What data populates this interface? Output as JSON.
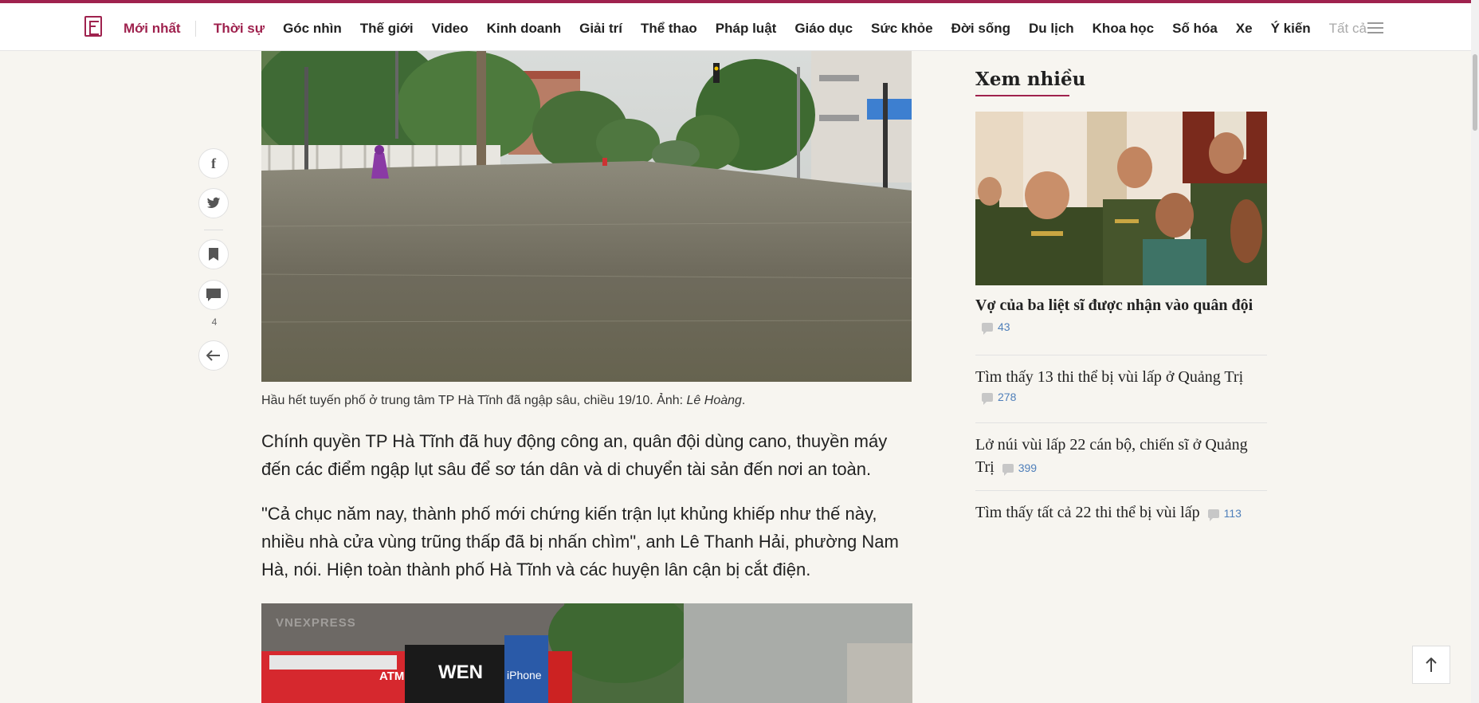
{
  "nav": {
    "latest": "Mới nhất",
    "items": [
      "Thời sự",
      "Góc nhìn",
      "Thế giới",
      "Video",
      "Kinh doanh",
      "Giải trí",
      "Thể thao",
      "Pháp luật",
      "Giáo dục",
      "Sức khỏe",
      "Đời sống",
      "Du lịch",
      "Khoa học",
      "Số hóa",
      "Xe",
      "Ý kiến"
    ],
    "all": "Tất cả",
    "active_index": 0
  },
  "social": {
    "comment_count": "4",
    "facebook_icon": "f"
  },
  "article": {
    "caption": "Hầu hết tuyến phố ở trung tâm TP Hà Tĩnh đã ngập sâu, chiều 19/10. Ảnh: ",
    "caption_author": "Lê Hoàng",
    "caption_end": ".",
    "para1": "Chính quyền TP Hà Tĩnh đã huy động công an, quân đội dùng cano, thuyền máy đến các điểm ngập lụt sâu để sơ tán dân và di chuyển tài sản đến nơi an toàn.",
    "para2": "\"Cả chục năm nay, thành phố mới chứng kiến trận lụt khủng khiếp như thế này, nhiều nhà cửa vùng trũng thấp đã bị nhấn chìm\", anh Lê Thanh Hải, phường Nam Hà, nói. Hiện toàn thành phố Hà Tĩnh và các huyện lân cận bị cắt điện.",
    "photo2_watermark": "VNEXPRESS",
    "photo2_sign1": "ATM",
    "photo2_sign2": "WEN",
    "photo2_sign3": "iPhone"
  },
  "sidebar": {
    "title": "Xem nhiều",
    "items": [
      {
        "title": "Vợ của ba liệt sĩ được nhận vào quân đội",
        "comments": "43"
      },
      {
        "title": "Tìm thấy 13 thi thể bị vùi lấp ở Quảng Trị",
        "comments": "278"
      },
      {
        "title": "Lở núi vùi lấp 22 cán bộ, chiến sĩ ở Quảng Trị",
        "comments": "399"
      },
      {
        "title": "Tìm thấy tất cả 22 thi thể bị vùi lấp",
        "comments": "113"
      }
    ]
  },
  "colors": {
    "brand": "#9f224e",
    "comment_link": "#4f7fba"
  }
}
